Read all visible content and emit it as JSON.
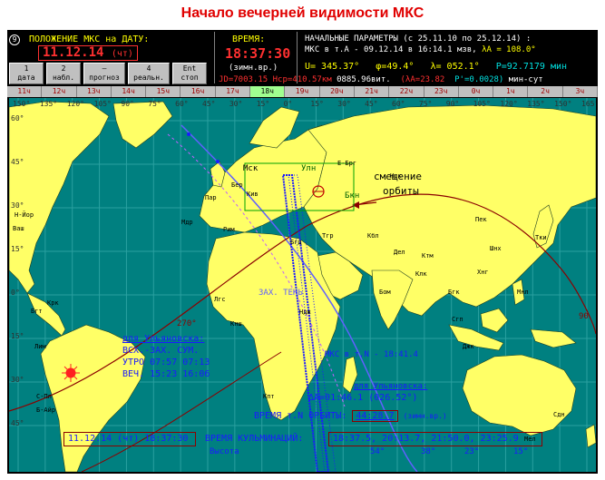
{
  "page_title": "Начало вечерней видимости МКС",
  "header": {
    "icon_symbol": "9",
    "position_label": "ПОЛОЖЕНИЕ МКС на ДАТУ:",
    "date": "11.12.14",
    "weekday": "(чт)",
    "time_label": "ВРЕМЯ:",
    "time_value": "18:37:30",
    "time_note": "(зимн.вр.)"
  },
  "buttons": [
    {
      "key": "1",
      "label": "дата"
    },
    {
      "key": "2",
      "label": "набл."
    },
    {
      "key": "–",
      "label": "прогноз"
    },
    {
      "key": "4",
      "label": "реальн."
    },
    {
      "key": "Ent",
      "label": "стоп"
    }
  ],
  "params": {
    "title": "НАЧАЛЬНЫЕ ПАРАМЕТРЫ  (с 25.11.10 по 25.12.14) :",
    "line2_a": "МКС в т.А - 09.12.14  в 16:14.1 мзв,",
    "line2_b": "λA = 108.0°",
    "u": "U= 345.37°",
    "phi": "φ=49.4°",
    "lambda": "λ= 052.1°",
    "period": "P=92.7179 мин",
    "jd": "JD=7003.15",
    "h": "Hср=410.57км",
    "rev": "0885.96вит.",
    "dlambda": "(λA=23.82",
    "dp": "P'=0.0028)",
    "dp_unit": "мин-сут"
  },
  "hour_strip": [
    "11ч",
    "12ч",
    "13ч",
    "14ч",
    "15ч",
    "16ч",
    "17ч",
    "18ч",
    "19ч",
    "20ч",
    "21ч",
    "22ч",
    "23ч",
    "0ч",
    "1ч",
    "2ч",
    "3ч"
  ],
  "hour_active": "18ч",
  "map": {
    "lon_labels": [
      "150°",
      "135°",
      "120°",
      "105°",
      "90°",
      "75°",
      "60°",
      "45°",
      "30°",
      "15°",
      "0°",
      "15°",
      "30°",
      "45°",
      "60°",
      "75°",
      "90°",
      "105°",
      "120°",
      "135°",
      "150°",
      "165°"
    ],
    "lat_labels": [
      "60°",
      "45°",
      "30°",
      "15°",
      "0°",
      "15°",
      "30°",
      "45°"
    ],
    "annotation_shift": "смещение",
    "annotation_orbit": "орбиты",
    "label_uln": "Улн",
    "label_bkn": "Бкн",
    "label_night": "ЗАХ.    ТЕНЬ",
    "label_270": "270°",
    "label_90": "90",
    "label_ms": "МКС в т.N - 18:41.4",
    "label_ul2": "для Ульяновска:",
    "label_delta": "ΔA=01:46.1",
    "label_delta_deg": "(026.52°)",
    "cities": [
      "Н-Йор",
      "Ваш",
      "Лим",
      "Б-Айр",
      "Р-Жан",
      "С-Пл",
      "Бгт",
      "Крк",
      "Мдр",
      "Рим",
      "Кпт",
      "Пар",
      "Бер",
      "Вршв",
      "Мск",
      "Е-Брг",
      "Нск",
      "Кив",
      "Тгр",
      "Бгд",
      "Днн",
      "Дел",
      "Бом",
      "Клк",
      "Пек",
      "Тки",
      "Шнх",
      "Хнг",
      "Мнл",
      "Сгп",
      "Джк",
      "Сдн",
      "Мел",
      "Лгс",
      "Кнш",
      "Ндж",
      "Пнд",
      "Кпт",
      "Бгк",
      "Кбл",
      "Кбл",
      "Тгр",
      "Ктм",
      "Ант"
    ]
  },
  "ulyanovsk": {
    "title": "для Ульяновска:",
    "head": "ВСХ.-ЗАХ.  СУМ.",
    "morning_label": "УТРО",
    "morning_rise": "07:57",
    "morning_set": "07:13",
    "evening_label": "ВЕЧ.",
    "evening_rise": "15:23",
    "evening_set": "16:06"
  },
  "orbit_time": {
    "label": "ВРЕМЯ т.N  ОРБИТЫ:",
    "value": "44:28.7",
    "note": "(зимн.вр.)"
  },
  "bottom": {
    "datetime": "11.12.14 (чт)  18:37:30",
    "culm_label": "ВРЕМЯ КУЛЬМИНАЦИЙ:",
    "culm_values": "18:37.5,  20:13.7,  21:50.0,  23:25.9",
    "height_label": "Высота",
    "heights": [
      "54°",
      "38°",
      "23°",
      "15°"
    ]
  },
  "colors": {
    "background": "#000000",
    "ocean": "#008080",
    "land": "#ffff66",
    "accent_red": "#ff3030",
    "accent_yellow": "#ffff00",
    "orbit_blue": "#1a1aff",
    "grid": "#2aa0a0"
  }
}
